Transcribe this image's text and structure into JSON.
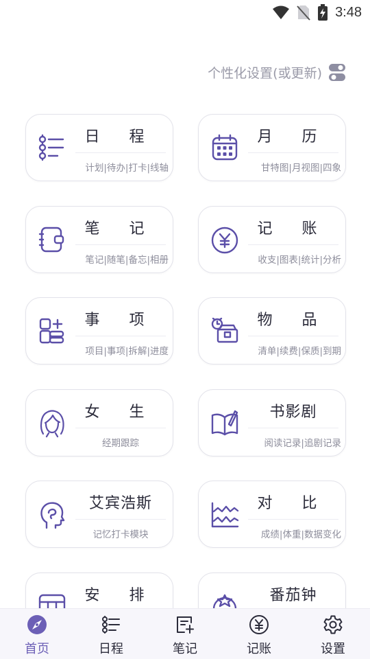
{
  "status_bar": {
    "time": "3:48"
  },
  "header": {
    "settings_text": "个性化设置(或更新)"
  },
  "cards": [
    {
      "title": "日 程",
      "sub": "计划|待办|打卡|线轴",
      "icon": "timeline-list-icon"
    },
    {
      "title": "月 历",
      "sub": "甘特图|月视图|四象",
      "icon": "calendar-icon"
    },
    {
      "title": "笔 记",
      "sub": "笔记|随笔|备忘|相册",
      "icon": "notebook-icon"
    },
    {
      "title": "记 账",
      "sub": "收支|图表|统计|分析",
      "icon": "yuan-coin-icon"
    },
    {
      "title": "事 项",
      "sub": "项目|事项|拆解|进度",
      "icon": "task-blocks-icon"
    },
    {
      "title": "物 品",
      "sub": "清单|续费|保质|到期",
      "icon": "box-alarm-icon"
    },
    {
      "title": "女 生",
      "sub": "经期跟踪",
      "icon": "woman-face-icon"
    },
    {
      "title": "书影剧",
      "sub": "阅读记录|追剧记录",
      "icon": "open-book-icon"
    },
    {
      "title": "艾宾浩斯",
      "sub": "记忆打卡模块",
      "icon": "head-brain-icon"
    },
    {
      "title": "对 比",
      "sub": "成绩|体重|数据变化",
      "icon": "wave-chart-icon"
    },
    {
      "title": "安 排",
      "sub": "",
      "icon": "schedule-grid-icon"
    },
    {
      "title": "番茄钟",
      "sub": "",
      "icon": "tomato-icon"
    }
  ],
  "bottom_nav": [
    {
      "label": "首页",
      "icon": "compass-icon",
      "active": true
    },
    {
      "label": "日程",
      "icon": "timeline-list-icon",
      "active": false
    },
    {
      "label": "笔记",
      "icon": "edit-note-icon",
      "active": false
    },
    {
      "label": "记账",
      "icon": "yuan-coin-icon",
      "active": false
    },
    {
      "label": "设置",
      "icon": "gear-icon",
      "active": false
    }
  ],
  "colors": {
    "accent": "#5b4fa8",
    "active_nav": "#6c5fb6",
    "text": "#2b2b3a",
    "muted": "#8e8e9c"
  }
}
